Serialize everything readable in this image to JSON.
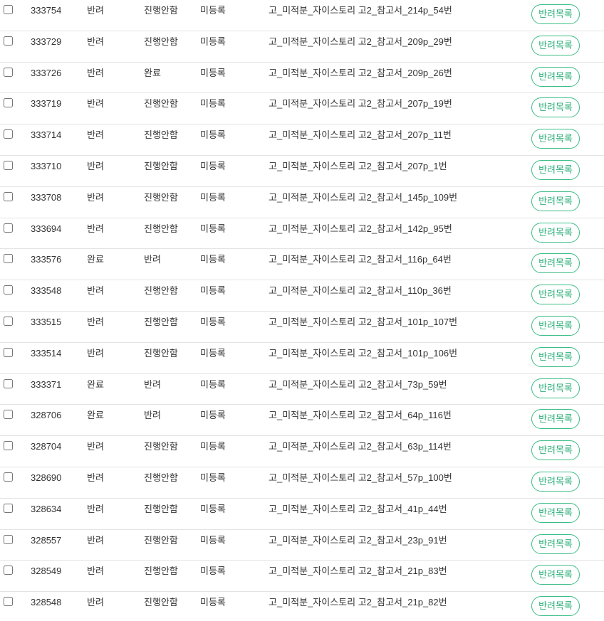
{
  "accent_color": "#3dbd86",
  "rows": [
    {
      "id": "333754",
      "status1": "반려",
      "status2": "진행안함",
      "reg": "미등록",
      "title": "고_미적분_자이스토리 고2_참고서_214p_54번",
      "button": "반려목록"
    },
    {
      "id": "333729",
      "status1": "반려",
      "status2": "진행안함",
      "reg": "미등록",
      "title": "고_미적분_자이스토리 고2_참고서_209p_29번",
      "button": "반려목록"
    },
    {
      "id": "333726",
      "status1": "반려",
      "status2": "완료",
      "reg": "미등록",
      "title": "고_미적분_자이스토리 고2_참고서_209p_26번",
      "button": "반려목록"
    },
    {
      "id": "333719",
      "status1": "반려",
      "status2": "진행안함",
      "reg": "미등록",
      "title": "고_미적분_자이스토리 고2_참고서_207p_19번",
      "button": "반려목록"
    },
    {
      "id": "333714",
      "status1": "반려",
      "status2": "진행안함",
      "reg": "미등록",
      "title": "고_미적분_자이스토리 고2_참고서_207p_11번",
      "button": "반려목록"
    },
    {
      "id": "333710",
      "status1": "반려",
      "status2": "진행안함",
      "reg": "미등록",
      "title": "고_미적분_자이스토리 고2_참고서_207p_1번",
      "button": "반려목록"
    },
    {
      "id": "333708",
      "status1": "반려",
      "status2": "진행안함",
      "reg": "미등록",
      "title": "고_미적분_자이스토리 고2_참고서_145p_109번",
      "button": "반려목록"
    },
    {
      "id": "333694",
      "status1": "반려",
      "status2": "진행안함",
      "reg": "미등록",
      "title": "고_미적분_자이스토리 고2_참고서_142p_95번",
      "button": "반려목록"
    },
    {
      "id": "333576",
      "status1": "완료",
      "status2": "반려",
      "reg": "미등록",
      "title": "고_미적분_자이스토리 고2_참고서_116p_64번",
      "button": "반려목록"
    },
    {
      "id": "333548",
      "status1": "반려",
      "status2": "진행안함",
      "reg": "미등록",
      "title": "고_미적분_자이스토리 고2_참고서_110p_36번",
      "button": "반려목록"
    },
    {
      "id": "333515",
      "status1": "반려",
      "status2": "진행안함",
      "reg": "미등록",
      "title": "고_미적분_자이스토리 고2_참고서_101p_107번",
      "button": "반려목록"
    },
    {
      "id": "333514",
      "status1": "반려",
      "status2": "진행안함",
      "reg": "미등록",
      "title": "고_미적분_자이스토리 고2_참고서_101p_106번",
      "button": "반려목록"
    },
    {
      "id": "333371",
      "status1": "완료",
      "status2": "반려",
      "reg": "미등록",
      "title": "고_미적분_자이스토리 고2_참고서_73p_59번",
      "button": "반려목록"
    },
    {
      "id": "328706",
      "status1": "완료",
      "status2": "반려",
      "reg": "미등록",
      "title": "고_미적분_자이스토리 고2_참고서_64p_116번",
      "button": "반려목록"
    },
    {
      "id": "328704",
      "status1": "반려",
      "status2": "진행안함",
      "reg": "미등록",
      "title": "고_미적분_자이스토리 고2_참고서_63p_114번",
      "button": "반려목록"
    },
    {
      "id": "328690",
      "status1": "반려",
      "status2": "진행안함",
      "reg": "미등록",
      "title": "고_미적분_자이스토리 고2_참고서_57p_100번",
      "button": "반려목록"
    },
    {
      "id": "328634",
      "status1": "반려",
      "status2": "진행안함",
      "reg": "미등록",
      "title": "고_미적분_자이스토리 고2_참고서_41p_44번",
      "button": "반려목록"
    },
    {
      "id": "328557",
      "status1": "반려",
      "status2": "진행안함",
      "reg": "미등록",
      "title": "고_미적분_자이스토리 고2_참고서_23p_91번",
      "button": "반려목록"
    },
    {
      "id": "328549",
      "status1": "반려",
      "status2": "진행안함",
      "reg": "미등록",
      "title": "고_미적분_자이스토리 고2_참고서_21p_83번",
      "button": "반려목록"
    },
    {
      "id": "328548",
      "status1": "반려",
      "status2": "진행안함",
      "reg": "미등록",
      "title": "고_미적분_자이스토리 고2_참고서_21p_82번",
      "button": "반려목록"
    }
  ]
}
